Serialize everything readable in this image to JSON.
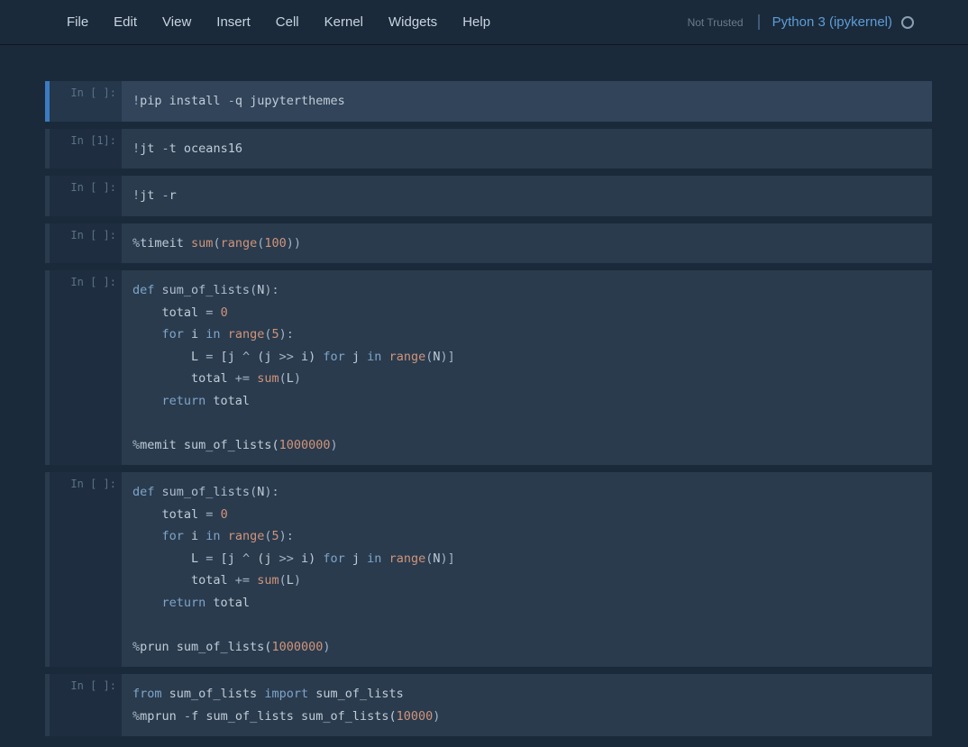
{
  "menu": {
    "items": [
      "File",
      "Edit",
      "View",
      "Insert",
      "Cell",
      "Kernel",
      "Widgets",
      "Help"
    ],
    "not_trusted": "Not Trusted",
    "kernel": "Python 3 (ipykernel)"
  },
  "cells": [
    {
      "prompt": "In [ ]:",
      "selected": true,
      "tokens": [
        [
          "op",
          "!"
        ],
        [
          "t",
          "pip install "
        ],
        [
          "op",
          "-"
        ],
        [
          "t",
          "q jupyterthemes"
        ]
      ]
    },
    {
      "prompt": "In [1]:",
      "selected": false,
      "tokens": [
        [
          "op",
          "!"
        ],
        [
          "t",
          "jt "
        ],
        [
          "op",
          "-"
        ],
        [
          "t",
          "t oceans16"
        ]
      ]
    },
    {
      "prompt": "In [ ]:",
      "selected": false,
      "tokens": [
        [
          "op",
          "!"
        ],
        [
          "t",
          "jt "
        ],
        [
          "op",
          "-"
        ],
        [
          "t",
          "r"
        ]
      ]
    },
    {
      "prompt": "In [ ]:",
      "selected": false,
      "tokens": [
        [
          "op",
          "%"
        ],
        [
          "t",
          "timeit "
        ],
        [
          "builtin",
          "sum"
        ],
        [
          "punc",
          "("
        ],
        [
          "builtin",
          "range"
        ],
        [
          "punc",
          "("
        ],
        [
          "num",
          "100"
        ],
        [
          "punc",
          "))"
        ]
      ]
    },
    {
      "prompt": "In [ ]:",
      "selected": false,
      "tokens": [
        [
          "kw",
          "def"
        ],
        [
          "t",
          " "
        ],
        [
          "def",
          "sum_of_lists"
        ],
        [
          "punc",
          "("
        ],
        [
          "t",
          "N"
        ],
        [
          "punc",
          "):"
        ],
        [
          "nl",
          ""
        ],
        [
          "t",
          "    total "
        ],
        [
          "op",
          "="
        ],
        [
          "t",
          " "
        ],
        [
          "num",
          "0"
        ],
        [
          "nl",
          ""
        ],
        [
          "t",
          "    "
        ],
        [
          "kw",
          "for"
        ],
        [
          "t",
          " i "
        ],
        [
          "kw",
          "in"
        ],
        [
          "t",
          " "
        ],
        [
          "builtin",
          "range"
        ],
        [
          "punc",
          "("
        ],
        [
          "num",
          "5"
        ],
        [
          "punc",
          "):"
        ],
        [
          "nl",
          ""
        ],
        [
          "t",
          "        L "
        ],
        [
          "op",
          "="
        ],
        [
          "t",
          " [j "
        ],
        [
          "op",
          "^"
        ],
        [
          "t",
          " (j "
        ],
        [
          "op",
          ">>"
        ],
        [
          "t",
          " i) "
        ],
        [
          "kw",
          "for"
        ],
        [
          "t",
          " j "
        ],
        [
          "kw",
          "in"
        ],
        [
          "t",
          " "
        ],
        [
          "builtin",
          "range"
        ],
        [
          "punc",
          "("
        ],
        [
          "t",
          "N"
        ],
        [
          "punc",
          ")]"
        ],
        [
          "nl",
          ""
        ],
        [
          "t",
          "        total "
        ],
        [
          "op",
          "+="
        ],
        [
          "t",
          " "
        ],
        [
          "builtin",
          "sum"
        ],
        [
          "punc",
          "("
        ],
        [
          "t",
          "L"
        ],
        [
          "punc",
          ")"
        ],
        [
          "nl",
          ""
        ],
        [
          "t",
          "    "
        ],
        [
          "kw",
          "return"
        ],
        [
          "t",
          " total"
        ],
        [
          "nl",
          ""
        ],
        [
          "nl",
          ""
        ],
        [
          "op",
          "%"
        ],
        [
          "t",
          "memit sum_of_lists("
        ],
        [
          "num",
          "1000000"
        ],
        [
          "punc",
          ")"
        ]
      ]
    },
    {
      "prompt": "In [ ]:",
      "selected": false,
      "tokens": [
        [
          "kw",
          "def"
        ],
        [
          "t",
          " "
        ],
        [
          "def",
          "sum_of_lists"
        ],
        [
          "punc",
          "("
        ],
        [
          "t",
          "N"
        ],
        [
          "punc",
          "):"
        ],
        [
          "nl",
          ""
        ],
        [
          "t",
          "    total "
        ],
        [
          "op",
          "="
        ],
        [
          "t",
          " "
        ],
        [
          "num",
          "0"
        ],
        [
          "nl",
          ""
        ],
        [
          "t",
          "    "
        ],
        [
          "kw",
          "for"
        ],
        [
          "t",
          " i "
        ],
        [
          "kw",
          "in"
        ],
        [
          "t",
          " "
        ],
        [
          "builtin",
          "range"
        ],
        [
          "punc",
          "("
        ],
        [
          "num",
          "5"
        ],
        [
          "punc",
          "):"
        ],
        [
          "nl",
          ""
        ],
        [
          "t",
          "        L "
        ],
        [
          "op",
          "="
        ],
        [
          "t",
          " [j "
        ],
        [
          "op",
          "^"
        ],
        [
          "t",
          " (j "
        ],
        [
          "op",
          ">>"
        ],
        [
          "t",
          " i) "
        ],
        [
          "kw",
          "for"
        ],
        [
          "t",
          " j "
        ],
        [
          "kw",
          "in"
        ],
        [
          "t",
          " "
        ],
        [
          "builtin",
          "range"
        ],
        [
          "punc",
          "("
        ],
        [
          "t",
          "N"
        ],
        [
          "punc",
          ")]"
        ],
        [
          "nl",
          ""
        ],
        [
          "t",
          "        total "
        ],
        [
          "op",
          "+="
        ],
        [
          "t",
          " "
        ],
        [
          "builtin",
          "sum"
        ],
        [
          "punc",
          "("
        ],
        [
          "t",
          "L"
        ],
        [
          "punc",
          ")"
        ],
        [
          "nl",
          ""
        ],
        [
          "t",
          "    "
        ],
        [
          "kw",
          "return"
        ],
        [
          "t",
          " total"
        ],
        [
          "nl",
          ""
        ],
        [
          "nl",
          ""
        ],
        [
          "op",
          "%"
        ],
        [
          "t",
          "prun sum_of_lists("
        ],
        [
          "num",
          "1000000"
        ],
        [
          "punc",
          ")"
        ]
      ]
    },
    {
      "prompt": "In [ ]:",
      "selected": false,
      "tokens": [
        [
          "kw",
          "from"
        ],
        [
          "t",
          " sum_of_lists "
        ],
        [
          "kw",
          "import"
        ],
        [
          "t",
          " sum_of_lists"
        ],
        [
          "nl",
          ""
        ],
        [
          "op",
          "%"
        ],
        [
          "t",
          "mprun "
        ],
        [
          "op",
          "-"
        ],
        [
          "t",
          "f sum_of_lists sum_of_lists("
        ],
        [
          "num",
          "10000"
        ],
        [
          "punc",
          ")"
        ]
      ]
    }
  ]
}
